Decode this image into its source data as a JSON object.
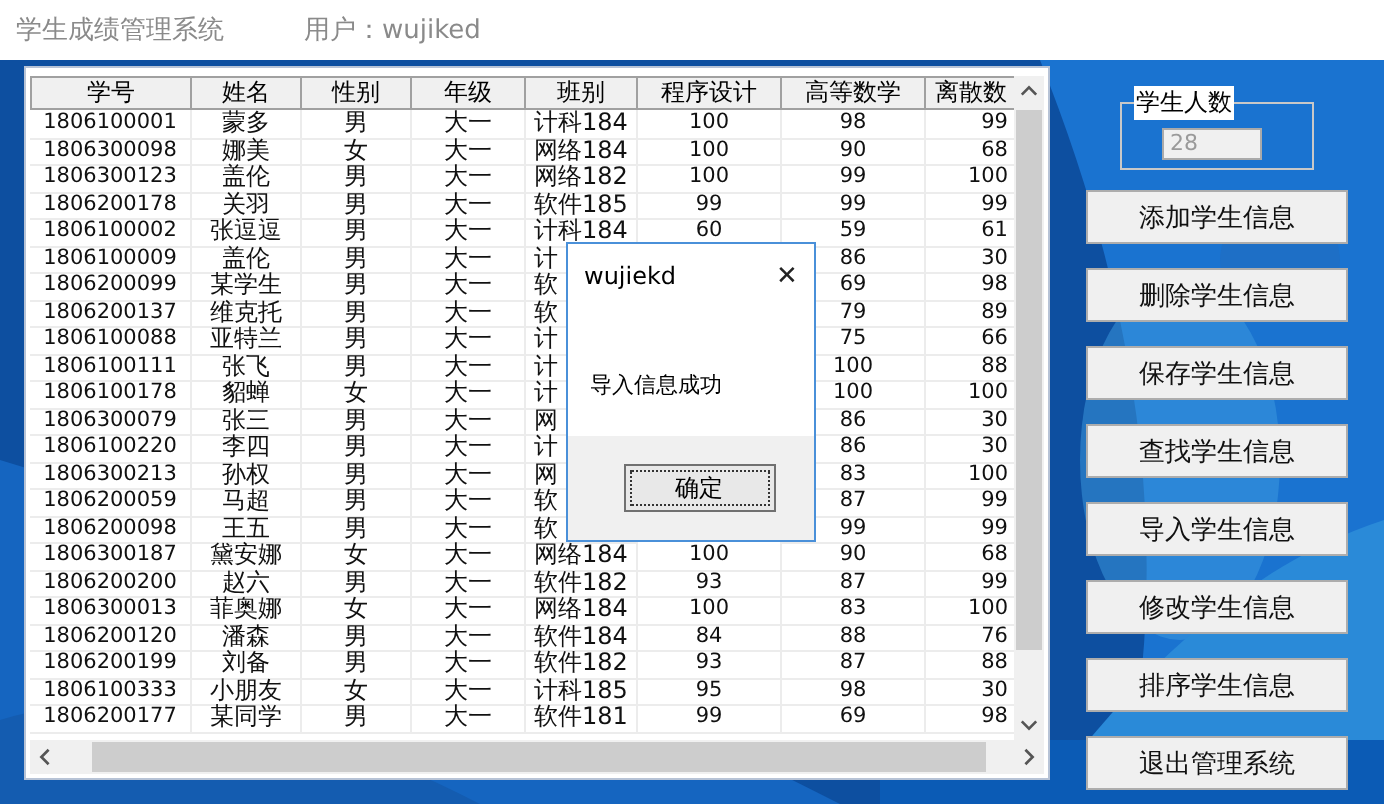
{
  "window": {
    "title": "学生成绩管理系统",
    "user": "用户：wujiked"
  },
  "table": {
    "columns": [
      "学号",
      "姓名",
      "性别",
      "年级",
      "班别",
      "程序设计",
      "高等数学",
      "离散数"
    ],
    "rows": [
      [
        "1806100001",
        "蒙多",
        "男",
        "大一",
        "计科184",
        "100",
        "98",
        "99"
      ],
      [
        "1806300098",
        "娜美",
        "女",
        "大一",
        "网络184",
        "100",
        "90",
        "68"
      ],
      [
        "1806300123",
        "盖伦",
        "男",
        "大一",
        "网络182",
        "100",
        "99",
        "100"
      ],
      [
        "1806200178",
        "关羽",
        "男",
        "大一",
        "软件185",
        "99",
        "99",
        "99"
      ],
      [
        "1806100002",
        "张逗逗",
        "男",
        "大一",
        "计科184",
        "60",
        "59",
        "61"
      ],
      [
        "1806100009",
        "盖伦",
        "男",
        "大一",
        "计",
        null,
        "86",
        "30"
      ],
      [
        "1806200099",
        "某学生",
        "男",
        "大一",
        "软",
        null,
        "69",
        "98"
      ],
      [
        "1806200137",
        "维克托",
        "男",
        "大一",
        "软",
        null,
        "79",
        "89"
      ],
      [
        "1806100088",
        "亚特兰",
        "男",
        "大一",
        "计",
        null,
        "75",
        "66"
      ],
      [
        "1806100111",
        "张飞",
        "男",
        "大一",
        "计",
        null,
        "100",
        "88"
      ],
      [
        "1806100178",
        "貂蝉",
        "女",
        "大一",
        "计",
        null,
        "100",
        "100"
      ],
      [
        "1806300079",
        "张三",
        "男",
        "大一",
        "网",
        null,
        "86",
        "30"
      ],
      [
        "1806100220",
        "李四",
        "男",
        "大一",
        "计",
        null,
        "86",
        "30"
      ],
      [
        "1806300213",
        "孙权",
        "男",
        "大一",
        "网",
        null,
        "83",
        "100"
      ],
      [
        "1806200059",
        "马超",
        "男",
        "大一",
        "软",
        null,
        "87",
        "99"
      ],
      [
        "1806200098",
        "王五",
        "男",
        "大一",
        "软",
        null,
        "99",
        "99"
      ],
      [
        "1806300187",
        "黛安娜",
        "女",
        "大一",
        "网络184",
        "100",
        "90",
        "68"
      ],
      [
        "1806200200",
        "赵六",
        "男",
        "大一",
        "软件182",
        "93",
        "87",
        "99"
      ],
      [
        "1806300013",
        "菲奥娜",
        "女",
        "大一",
        "网络184",
        "100",
        "83",
        "100"
      ],
      [
        "1806200120",
        "潘森",
        "男",
        "大一",
        "软件184",
        "84",
        "88",
        "76"
      ],
      [
        "1806200199",
        "刘备",
        "男",
        "大一",
        "软件182",
        "93",
        "87",
        "88"
      ],
      [
        "1806100333",
        "小朋友",
        "女",
        "大一",
        "计科185",
        "95",
        "98",
        "30"
      ],
      [
        "1806200177",
        "某同学",
        "男",
        "大一",
        "软件181",
        "99",
        "69",
        "98"
      ]
    ]
  },
  "student_count": {
    "label": "学生人数",
    "value": "28"
  },
  "buttons": [
    "添加学生信息",
    "删除学生信息",
    "保存学生信息",
    "查找学生信息",
    "导入学生信息",
    "修改学生信息",
    "排序学生信息",
    "退出管理系统"
  ],
  "dialog": {
    "title": "wujiekd",
    "close": "✕",
    "message": "导入信息成功",
    "button": "确定"
  }
}
